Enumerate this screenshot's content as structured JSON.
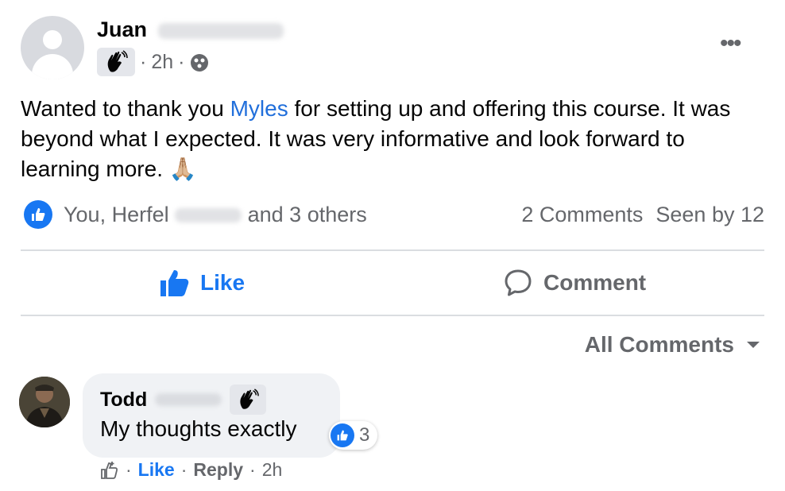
{
  "post": {
    "author_first": "Juan",
    "time": "2h",
    "separator": "·",
    "more_label": "•••",
    "text_before": "Wanted to thank you ",
    "mention": "Myles",
    "text_after": " for setting up and offering this course. It was beyond what I expected.  It was very informative and look forward to learning more.  🙏🏼",
    "reactions_prefix": "You, Herfel",
    "reactions_suffix": "and 3 others",
    "comments_count": "2 Comments",
    "seen_by": "Seen by 12",
    "like_label": "Like",
    "comment_label": "Comment",
    "icons": [
      "wave-icon",
      "group-privacy-icon",
      "more-icon",
      "like-icon",
      "comment-icon"
    ]
  },
  "comments_header": {
    "label": "All Comments",
    "icon": "caret-down-icon"
  },
  "comment": {
    "author_first": "Todd",
    "text": "My thoughts exactly",
    "reaction_count": "3",
    "like_label": "Like",
    "reply_label": "Reply",
    "time": "2h",
    "separator": "·"
  },
  "colors": {
    "brand_blue": "#1877f2",
    "mention_blue": "#216fdb",
    "muted_text": "#65676b",
    "divider": "#dadde1",
    "bubble": "#f0f2f5"
  }
}
